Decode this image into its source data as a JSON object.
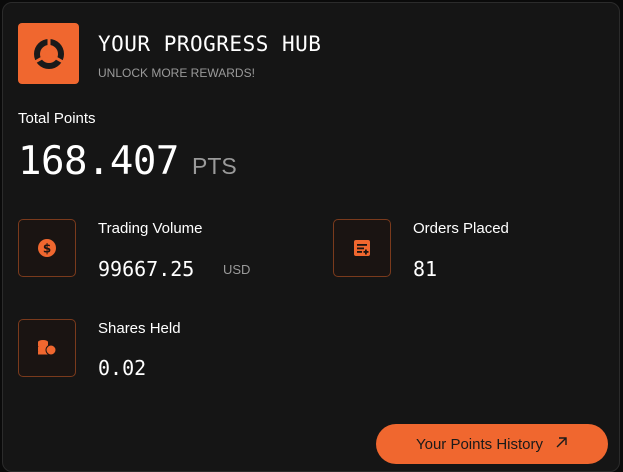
{
  "header": {
    "title": "YOUR PROGRESS HUB",
    "subtitle": "UNLOCK MORE REWARDS!",
    "logo_icon": "progress-ring-icon"
  },
  "total": {
    "label": "Total Points",
    "value": "168.407",
    "unit": "PTS"
  },
  "stats": [
    {
      "label": "Trading Volume",
      "value": "99667.25",
      "unit": "USD",
      "icon": "dollar-coin-icon"
    },
    {
      "label": "Orders Placed",
      "value": "81",
      "unit": "",
      "icon": "order-document-icon"
    },
    {
      "label": "Shares Held",
      "value": "0.02",
      "unit": "",
      "icon": "coin-stack-icon"
    }
  ],
  "history_button": {
    "label": "Your Points History",
    "icon": "arrow-up-right-icon"
  },
  "colors": {
    "accent": "#f0672f",
    "background": "#151515",
    "muted": "#9a9a9a"
  }
}
